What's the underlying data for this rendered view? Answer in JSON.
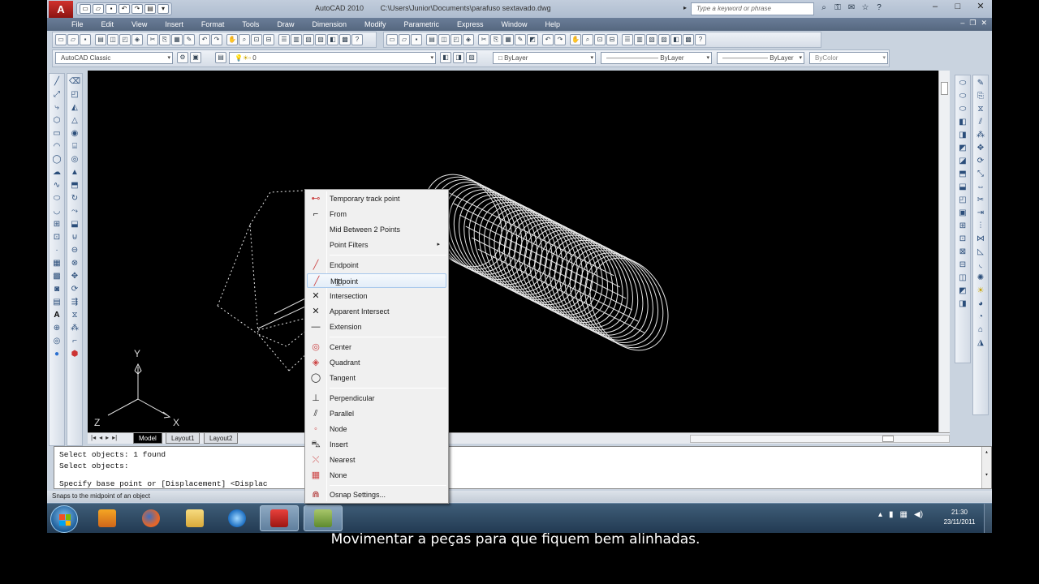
{
  "titlebar": {
    "app_name": "AutoCAD 2010",
    "file_path": "C:\\Users\\Junior\\Documents\\parafuso sextavado.dwg",
    "search_placeholder": "Type a keyword or phrase",
    "logo_letter": "A"
  },
  "menubar": {
    "items": [
      "File",
      "Edit",
      "View",
      "Insert",
      "Format",
      "Tools",
      "Draw",
      "Dimension",
      "Modify",
      "Parametric",
      "Express",
      "Window",
      "Help"
    ]
  },
  "toolbars": {
    "workspace": "AutoCAD Classic",
    "layer": "0",
    "color": "ByLayer",
    "linetype": "ByLayer",
    "lineweight": "ByLayer",
    "plotstyle": "ByColor"
  },
  "tabs": {
    "model": "Model",
    "layout1": "Layout1",
    "layout2": "Layout2"
  },
  "ucs": {
    "y": "Y",
    "z": "Z",
    "x": "X"
  },
  "command": {
    "lines": [
      "Select objects: 1 found",
      "Select objects:",
      "",
      "Specify base point or [Displacement] <Displac"
    ]
  },
  "status": {
    "hint": "Snaps to the midpoint of an object"
  },
  "osnap_menu": {
    "items": [
      {
        "label": "Temporary track point",
        "icon": "track-point-icon"
      },
      {
        "label": "From",
        "icon": "from-icon"
      },
      {
        "label": "Mid Between 2 Points",
        "icon": "none"
      },
      {
        "label": "Point Filters",
        "icon": "none"
      },
      {
        "label": "Endpoint",
        "icon": "endpoint-icon"
      },
      {
        "label": "Midpoint",
        "icon": "midpoint-icon"
      },
      {
        "label": "Intersection",
        "icon": "intersection-icon"
      },
      {
        "label": "Apparent Intersect",
        "icon": "apparent-intersect-icon"
      },
      {
        "label": "Extension",
        "icon": "extension-icon"
      },
      {
        "label": "Center",
        "icon": "center-icon"
      },
      {
        "label": "Quadrant",
        "icon": "quadrant-icon"
      },
      {
        "label": "Tangent",
        "icon": "tangent-icon"
      },
      {
        "label": "Perpendicular",
        "icon": "perpendicular-icon"
      },
      {
        "label": "Parallel",
        "icon": "parallel-icon"
      },
      {
        "label": "Node",
        "icon": "node-icon"
      },
      {
        "label": "Insert",
        "icon": "insert-icon"
      },
      {
        "label": "Nearest",
        "icon": "nearest-icon"
      },
      {
        "label": "None",
        "icon": "none-snap-icon"
      },
      {
        "label": "Osnap Settings...",
        "icon": "osnap-settings-icon"
      }
    ],
    "highlighted": "Midpoint",
    "submenu_arrow": "▸"
  },
  "taskbar": {
    "time": "21:30",
    "date": "23/11/2011"
  },
  "subtitle": "Movimentar a peças para que fiquem bem alinhadas.",
  "colors": {
    "accent": "#d0312d",
    "taskbar": "#223a52",
    "drawing_bg": "#000000",
    "menu_highlight": "#a8c8eb"
  }
}
